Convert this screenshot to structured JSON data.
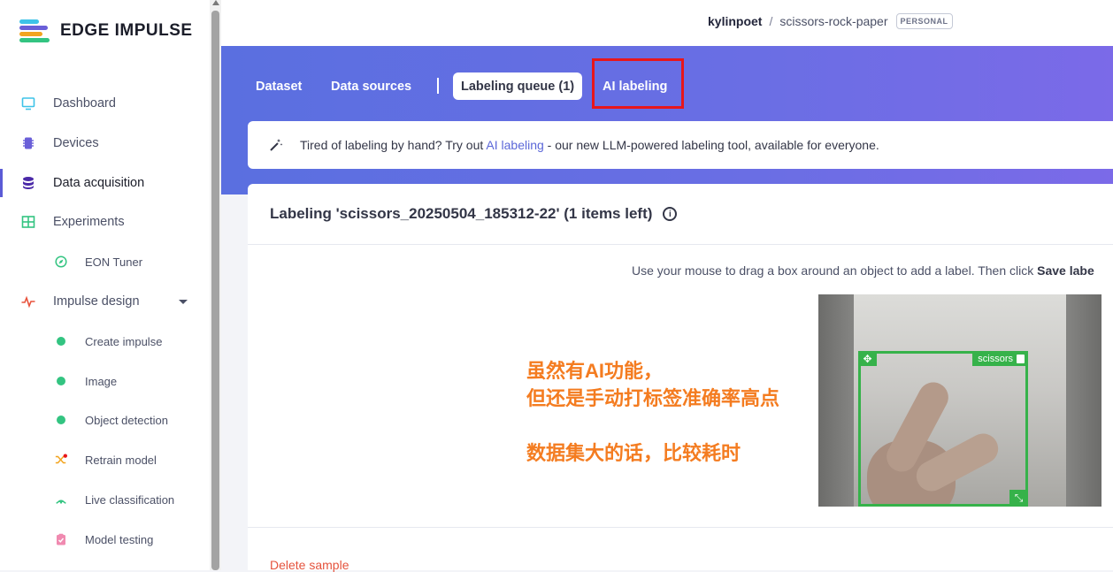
{
  "brand": {
    "name": "EDGE IMPULSE"
  },
  "sidebar": {
    "items": [
      {
        "label": "Dashboard",
        "icon": "monitor-icon"
      },
      {
        "label": "Devices",
        "icon": "chip-icon"
      },
      {
        "label": "Data acquisition",
        "icon": "database-icon",
        "active": true
      },
      {
        "label": "Experiments",
        "icon": "table-icon"
      },
      {
        "label": "EON Tuner",
        "icon": "compass-icon"
      },
      {
        "label": "Impulse design",
        "icon": "pulse-icon"
      },
      {
        "label": "Create impulse",
        "icon": "dot-icon"
      },
      {
        "label": "Image",
        "icon": "dot-icon"
      },
      {
        "label": "Object detection",
        "icon": "dot-icon"
      },
      {
        "label": "Retrain model",
        "icon": "shuffle-icon"
      },
      {
        "label": "Live classification",
        "icon": "signal-icon"
      },
      {
        "label": "Model testing",
        "icon": "clipboard-check-icon"
      }
    ]
  },
  "header": {
    "user": "kylinpoet",
    "separator": "/",
    "project": "scissors-rock-paper",
    "badge": "PERSONAL"
  },
  "tabs": {
    "dataset": "Dataset",
    "data_sources": "Data sources",
    "divider": "|",
    "labeling_queue": "Labeling queue (1)",
    "ai_labeling": "AI labeling"
  },
  "notice": {
    "prefix": "Tired of labeling by hand? Try out ",
    "link": "AI labeling",
    "suffix": " - our new LLM-powered labeling tool, available for everyone."
  },
  "labeling": {
    "title": "Labeling 'scissors_20250504_185312-22' (1 items left)",
    "info_glyph": "i",
    "instruction_prefix": "Use your mouse to drag a box around an object to add a label. Then click ",
    "instruction_bold": "Save labe",
    "bbox_label": "scissors",
    "bbox_move_glyph": "✥",
    "bbox_resize_glyph": "⤡",
    "delete": "Delete sample"
  },
  "annotation": {
    "line1": "虽然有AI功能，",
    "line2": "但还是手动打标签准确率高点",
    "line3": "数据集大的话，比较耗时"
  },
  "colors": {
    "accent": "#5b5bd6",
    "annotation": "#f47c20",
    "bbox": "#36b24a",
    "highlight": "#e8161b",
    "delete": "#e5533d"
  }
}
